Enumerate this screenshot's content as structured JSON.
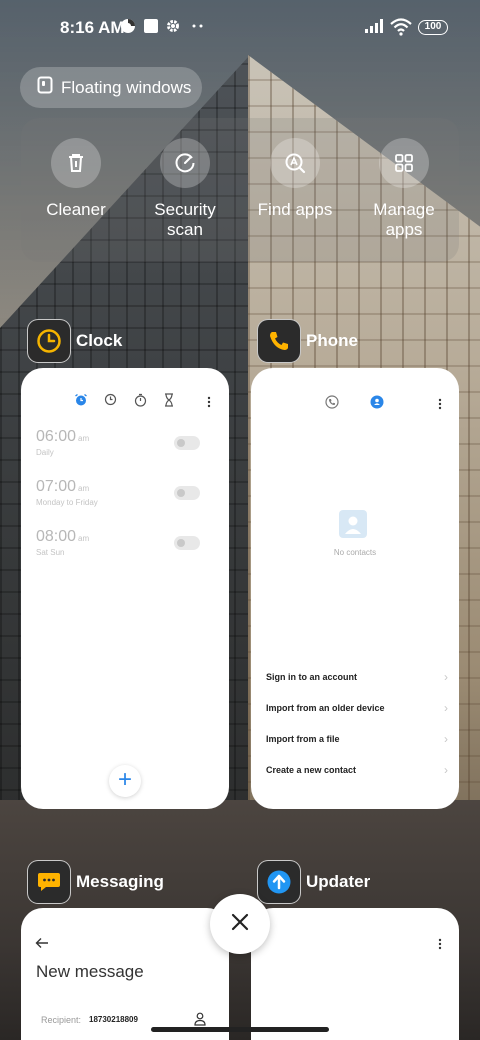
{
  "status_bar": {
    "time": "8:16 AM",
    "battery": "100",
    "icons": [
      "data-saver-icon",
      "square-notification-icon",
      "settings-gear-icon",
      "more-dots-icon",
      "signal-icon",
      "wifi-icon"
    ]
  },
  "floating_windows": {
    "label": "Floating windows",
    "icon": "floating-window-icon"
  },
  "quick_actions": [
    {
      "label": "Cleaner",
      "icon": "trash-icon"
    },
    {
      "label": "Security scan",
      "icon": "gauge-icon"
    },
    {
      "label": "Find apps",
      "icon": "search-apps-icon"
    },
    {
      "label": "Manage apps",
      "icon": "grid-icon"
    }
  ],
  "apps": {
    "clock": {
      "title": "Clock",
      "alarms": [
        {
          "time": "06:00",
          "ampm": "am",
          "repeat": "Daily"
        },
        {
          "time": "07:00",
          "ampm": "am",
          "repeat": "Monday to Friday"
        },
        {
          "time": "08:00",
          "ampm": "am",
          "repeat": "Sat Sun"
        }
      ],
      "fab": "+"
    },
    "phone": {
      "title": "Phone",
      "empty_text": "No contacts",
      "menu": [
        "Sign in to an account",
        "Import from an older device",
        "Import from a file",
        "Create a new contact"
      ]
    },
    "messaging": {
      "title": "Messaging",
      "heading": "New message",
      "recipient_label": "Recipient:",
      "recipient_value": "18730218809"
    },
    "updater": {
      "title": "Updater"
    }
  },
  "colors": {
    "accent_blue": "#2a86e8",
    "clock_yellow": "#f5b400",
    "phone_yellow": "#ffb300",
    "updater_blue": "#2196f3"
  }
}
